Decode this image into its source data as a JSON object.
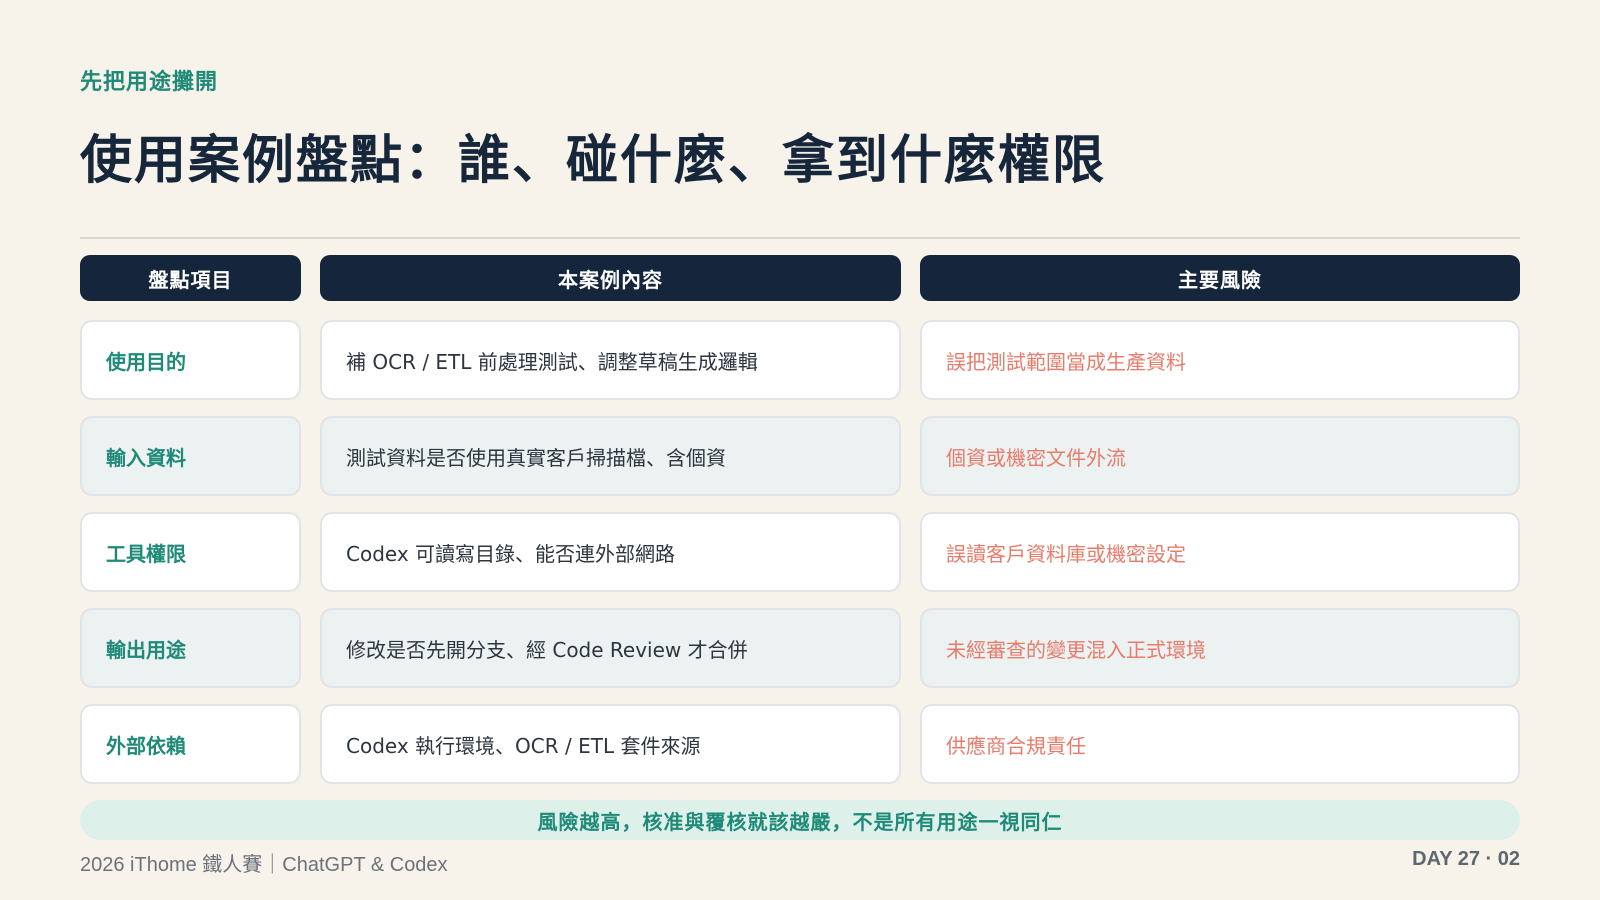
{
  "eyebrow": "先把用途攤開",
  "title": "使用案例盤點：誰、碰什麼、拿到什麼權限",
  "table": {
    "headers": [
      "盤點項目",
      "本案例內容",
      "主要風險"
    ],
    "rows": [
      {
        "item": "使用目的",
        "content": "補 OCR / ETL 前處理測試、調整草稿生成邏輯",
        "risk": "誤把測試範圍當成生產資料"
      },
      {
        "item": "輸入資料",
        "content": "測試資料是否使用真實客戶掃描檔、含個資",
        "risk": "個資或機密文件外流"
      },
      {
        "item": "工具權限",
        "content": "Codex 可讀寫目錄、能否連外部網路",
        "risk": "誤讀客戶資料庫或機密設定"
      },
      {
        "item": "輸出用途",
        "content": "修改是否先開分支、經 Code Review 才合併",
        "risk": "未經審查的變更混入正式環境"
      },
      {
        "item": "外部依賴",
        "content": "Codex 執行環境、OCR / ETL 套件來源",
        "risk": "供應商合規責任"
      }
    ]
  },
  "banner": "風險越高，核准與覆核就該越嚴，不是所有用途一視同仁",
  "footer": {
    "left": "2026 iThome 鐵人賽｜ChatGPT & Codex",
    "right": "DAY 27 · 02"
  },
  "colors": {
    "background": "#f7f3ea",
    "accent": "#1f8a78",
    "header": "#15253b",
    "risk": "#e77c6b"
  }
}
